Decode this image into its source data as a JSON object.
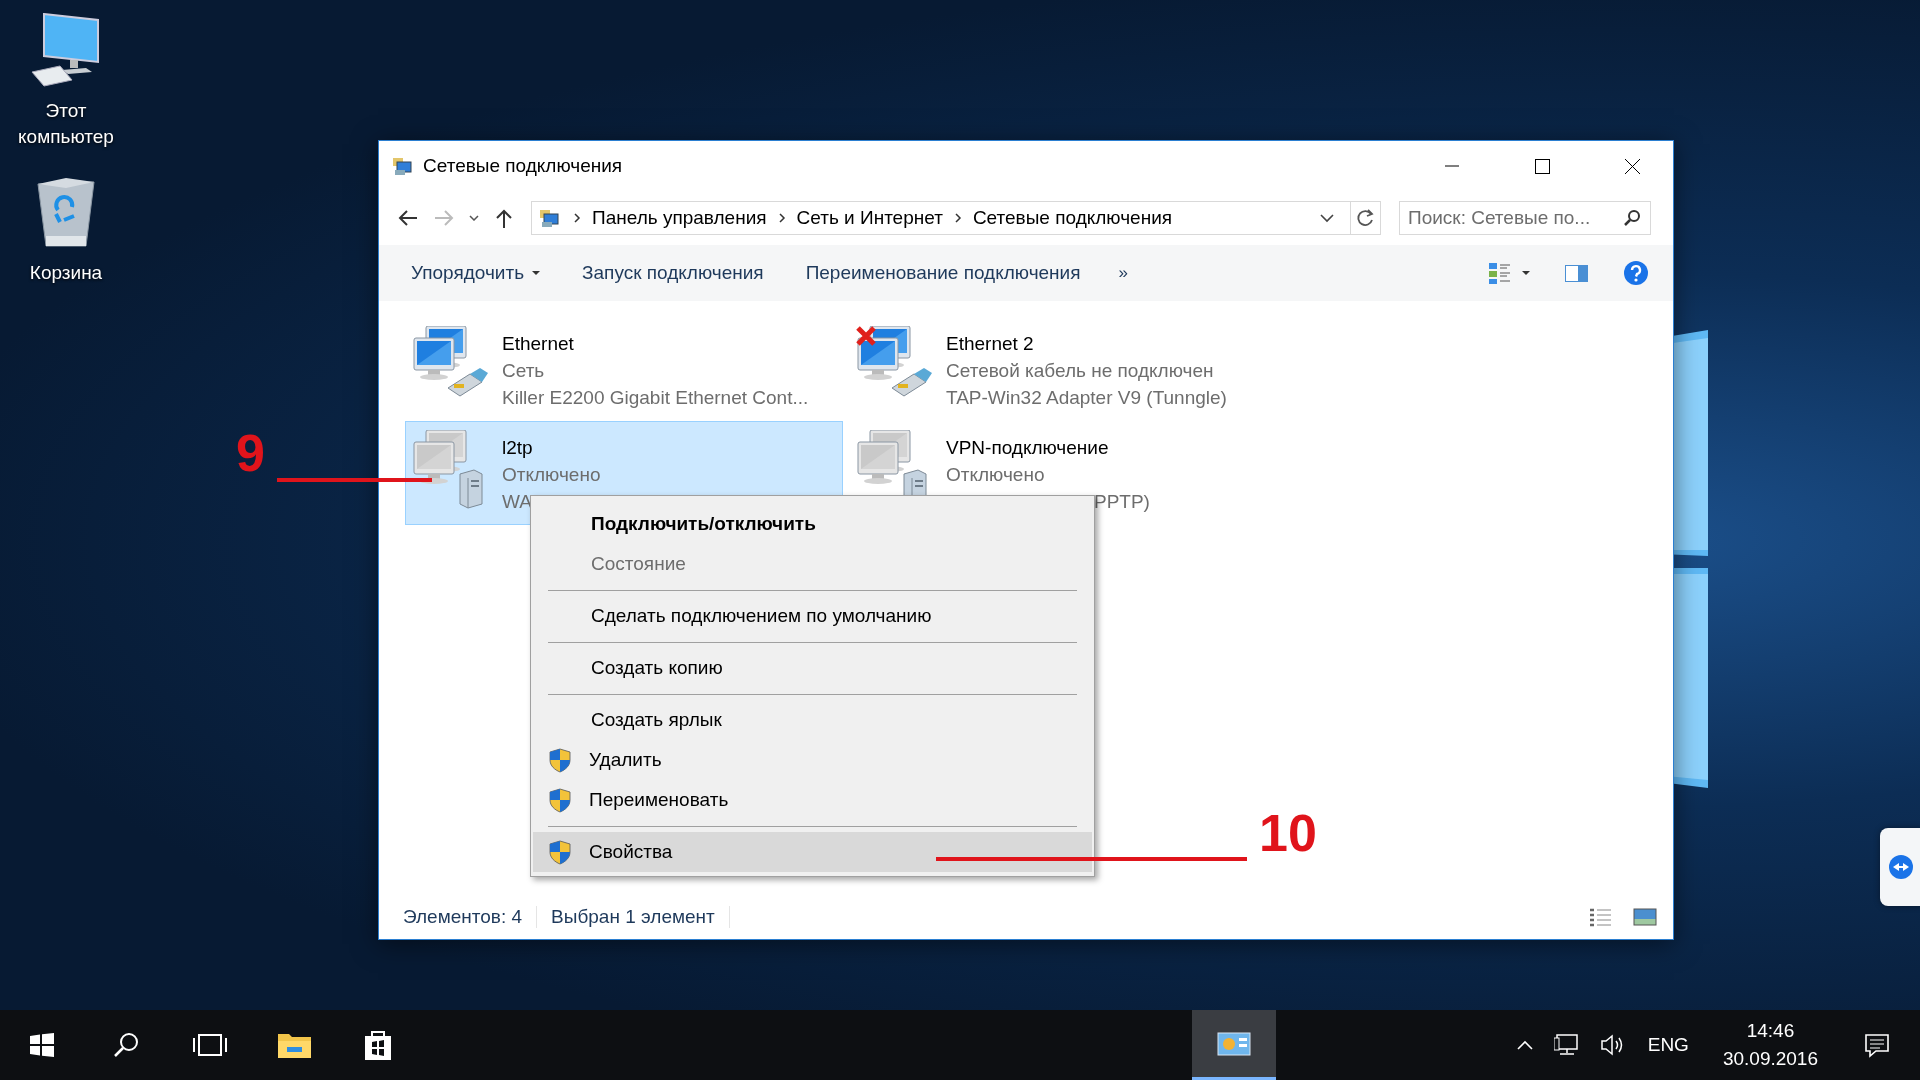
{
  "desktop_icons": [
    {
      "label": "Этот компьютер",
      "kind": "computer"
    },
    {
      "label": "Корзина",
      "kind": "recycle"
    }
  ],
  "window": {
    "title": "Сетевые подключения",
    "breadcrumb": [
      "Панель управления",
      "Сеть и Интернет",
      "Сетевые подключения"
    ],
    "search": {
      "placeholder": "Поиск: Сетевые по..."
    },
    "toolbar": [
      {
        "label": "Упорядочить",
        "dropdown": true
      },
      {
        "label": "Запуск подключения",
        "dropdown": false
      },
      {
        "label": "Переименование подключения",
        "dropdown": false
      }
    ],
    "toolbar_more": "»"
  },
  "connections": [
    {
      "name": "Ethernet",
      "status": "Сеть",
      "device": "Killer E2200 Gigabit Ethernet Cont...",
      "kind": "ethernet",
      "disconnected": false,
      "selected": false
    },
    {
      "name": "Ethernet 2",
      "status": "Сетевой кабель не подключен",
      "device": "TAP-Win32 Adapter V9 (Tunngle)",
      "kind": "ethernet",
      "disconnected": true,
      "selected": false
    },
    {
      "name": "l2tp",
      "status": "Отключено",
      "device": "WA",
      "kind": "vpn",
      "disconnected": false,
      "selected": true
    },
    {
      "name": "VPN-подключение",
      "status": "Отключено",
      "device": "PPTP)",
      "kind": "vpn",
      "disconnected": false,
      "selected": false
    }
  ],
  "context_menu": {
    "items": [
      {
        "kind": "item",
        "label": "Подключить/отключить",
        "default": true,
        "disabled": false,
        "shield": false,
        "selected": false
      },
      {
        "kind": "item",
        "label": "Состояние",
        "default": false,
        "disabled": true,
        "shield": false,
        "selected": false
      },
      {
        "kind": "separator"
      },
      {
        "kind": "item",
        "label": "Сделать подключением по умолчанию",
        "default": false,
        "disabled": false,
        "shield": false,
        "selected": false
      },
      {
        "kind": "separator"
      },
      {
        "kind": "item",
        "label": "Создать копию",
        "default": false,
        "disabled": false,
        "shield": false,
        "selected": false
      },
      {
        "kind": "separator"
      },
      {
        "kind": "item",
        "label": "Создать ярлык",
        "default": false,
        "disabled": false,
        "shield": false,
        "selected": false
      },
      {
        "kind": "item",
        "label": "Удалить",
        "default": false,
        "disabled": false,
        "shield": true,
        "selected": false
      },
      {
        "kind": "item",
        "label": "Переименовать",
        "default": false,
        "disabled": false,
        "shield": true,
        "selected": false
      },
      {
        "kind": "separator"
      },
      {
        "kind": "item",
        "label": "Свойства",
        "default": false,
        "disabled": false,
        "shield": true,
        "selected": true
      }
    ]
  },
  "status_bar": {
    "count": "Элементов: 4",
    "selection": "Выбран 1 элемент"
  },
  "annotations": [
    {
      "label": "9"
    },
    {
      "label": "10"
    }
  ],
  "taskbar": {
    "language": "ENG",
    "time": "14:46",
    "date": "30.09.2016"
  }
}
